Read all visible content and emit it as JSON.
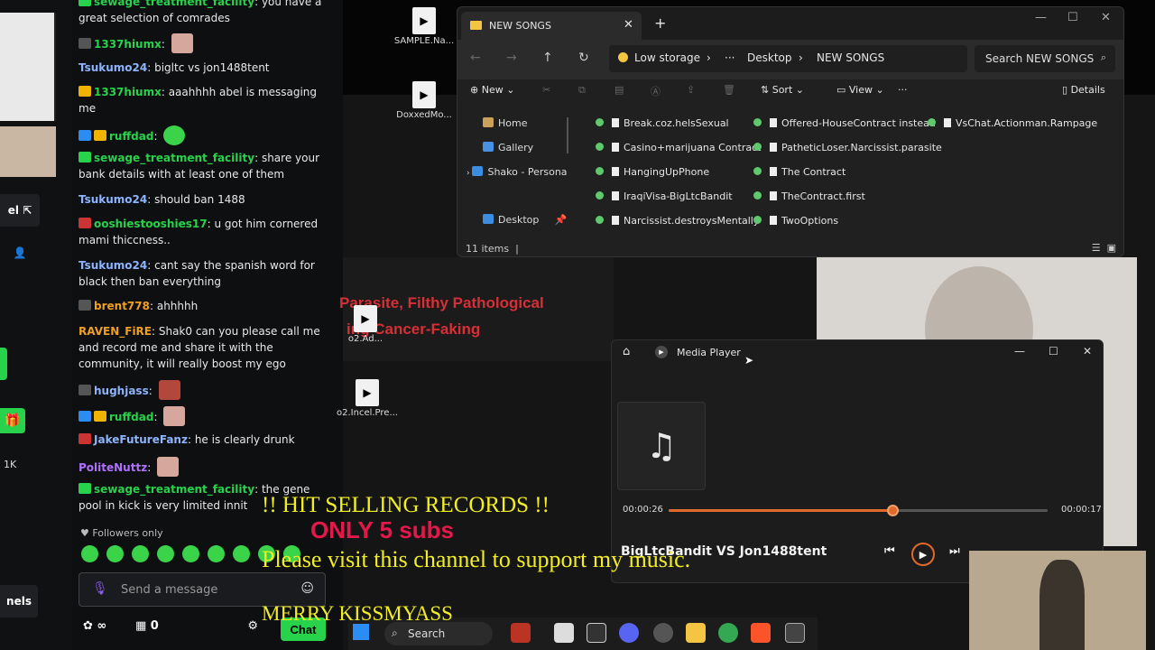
{
  "rail": {
    "btn_top": "el",
    "btn_bottom": "nels",
    "count": "1K"
  },
  "chat": {
    "messages": [
      {
        "user": "sewage_treatment_facility",
        "color": "#ffffff",
        "text": "you have a great selection of comrades"
      },
      {
        "user": "1337hiumx",
        "color": "#28d24a",
        "text": ""
      },
      {
        "user": "Tsukumo24",
        "color": "#8cb4ff",
        "text": "bigltc vs jon1488tent"
      },
      {
        "user": "1337hiumx",
        "color": "#28d24a",
        "text": "aaahhhh abel is messaging me"
      },
      {
        "user": "ruffdad",
        "color": "#28d24a",
        "text": ""
      },
      {
        "user": "sewage_treatment_facility",
        "color": "#28d24a",
        "text": "share your bank details with at least one of them"
      },
      {
        "user": "Tsukumo24",
        "color": "#8cb4ff",
        "text": "should ban 1488"
      },
      {
        "user": "ooshiestooshies17",
        "color": "#28d24a",
        "text": "u got him cornered mami thiccness.."
      },
      {
        "user": "Tsukumo24",
        "color": "#8cb4ff",
        "text": "cant say the spanish word for black then ban everything"
      },
      {
        "user": "brent778",
        "color": "#f0a020",
        "text": "ahhhhh"
      },
      {
        "user": "RAVEN_FiRE",
        "color": "#f0a020",
        "text": "Shak0 can you please call me and record me and share it with the community, it will really boost my ego"
      },
      {
        "user": "hughjass",
        "color": "#8cb4ff",
        "text": ""
      },
      {
        "user": "ruffdad",
        "color": "#28d24a",
        "text": ""
      },
      {
        "user": "JakeFutureFanz",
        "color": "#8cb4ff",
        "text": "he is clearly drunk"
      },
      {
        "user": "PoliteNuttz",
        "color": "#b070ff",
        "text": ""
      },
      {
        "user": "sewage_treatment_facility",
        "color": "#28d24a",
        "text": "the gene pool in kick is very limited innit"
      }
    ],
    "followers_only": "Followers only",
    "send_placeholder": "Send a message",
    "footer_count": "0",
    "chat_button": "Chat"
  },
  "desktop": {
    "slide_line1": "Parasite, Filthy Pathological",
    "slide_line2": "ing Cancer-Faking",
    "icons": [
      {
        "label": "SAMPLE.Na..."
      },
      {
        "label": "DoxxedMo..."
      },
      {
        "label": "o2.Ad..."
      },
      {
        "label": "o2.Incel.Pre..."
      }
    ]
  },
  "explorer": {
    "tab_title": "NEW SONGS",
    "address": [
      "Low storage",
      "Desktop",
      "NEW SONGS"
    ],
    "search_placeholder": "Search NEW SONGS",
    "commands": {
      "new": "New",
      "sort": "Sort",
      "view": "View",
      "details": "Details"
    },
    "sidebar": [
      "Home",
      "Gallery",
      "Shako - Persona",
      "Desktop"
    ],
    "files": [
      "Break.coz.helsSexual",
      "Casino+marijuana Contract",
      "HangingUpPhone",
      "IraqiVisa-BigLtcBandit",
      "Narcissist.destroysMentally",
      "Offered-HouseContract instead",
      "PatheticLoser.Narcissist.parasite",
      "The Contract",
      "TheContract.first",
      "TwoOptions",
      "VsChat.Actionman.Rampage"
    ],
    "status": "11 items"
  },
  "player": {
    "title": "Media Player",
    "elapsed": "00:00:26",
    "remaining": "00:00:17",
    "progress": 0.59,
    "song": "BigLtcBandit VS Jon1488tent"
  },
  "overlays": {
    "line1": "!! HIT SELLING RECORDS !!",
    "line2": "ONLY 5 subs",
    "line3": "Please visit this channel to support my music.",
    "line4": "MERRY KISSMYASS"
  },
  "taskbar": {
    "search": "Search"
  },
  "colors": {
    "accent_green": "#28d24a",
    "accent_orange": "#e06a2c",
    "overlay_yellow": "#f2ee24",
    "overlay_red": "#e4184a"
  }
}
